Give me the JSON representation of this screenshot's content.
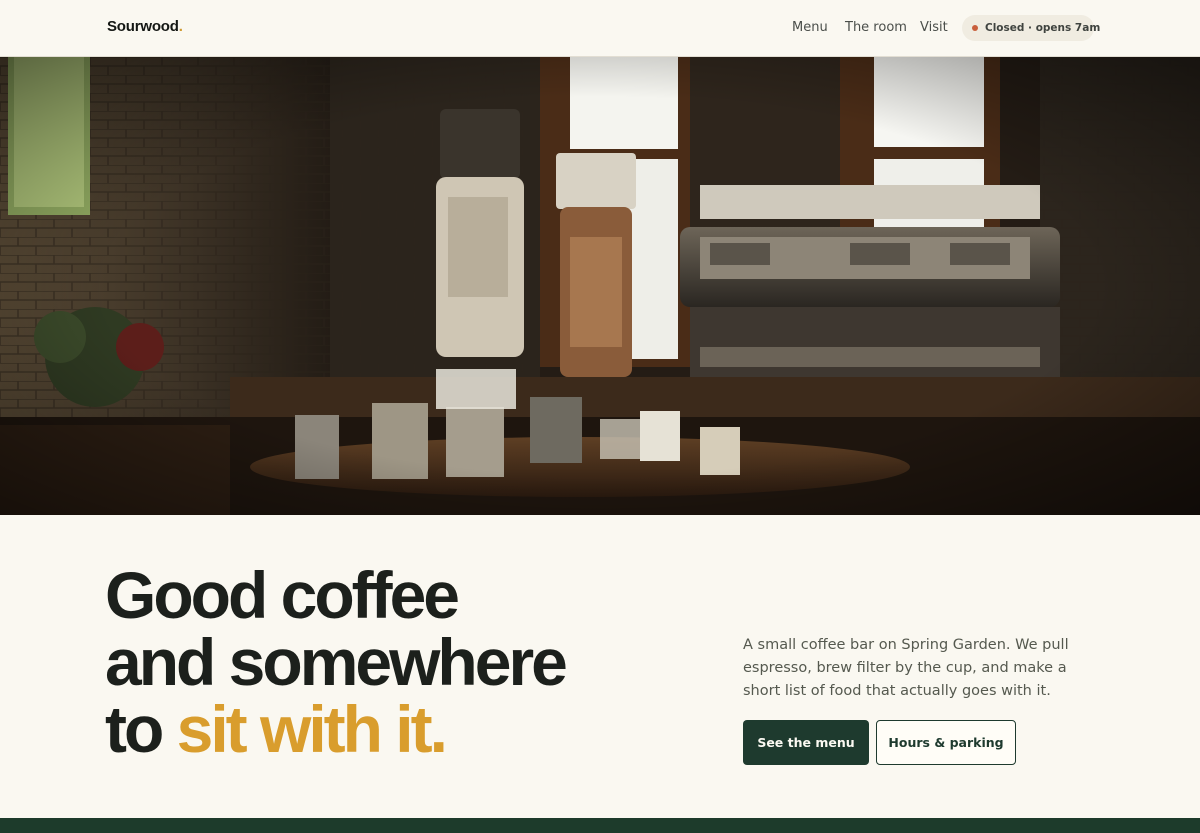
{
  "brand": {
    "name": "Sourwood",
    "dot": "."
  },
  "nav": {
    "items": [
      {
        "label": "Menu"
      },
      {
        "label": "The room"
      },
      {
        "label": "Visit"
      }
    ],
    "status": {
      "text": "Closed · opens 7am",
      "dot_color": "#c95f3c"
    }
  },
  "hero_image": {
    "subject": "espresso-bar-photo"
  },
  "headline": {
    "line1": "Good coffee",
    "line2": "and somewhere",
    "line3_lead": "to",
    "line3_accent": "sit with it."
  },
  "intro": {
    "text": "A small coffee bar on Spring Garden. We pull espresso, brew filter by the cup, and make a short list of food that actually goes with it."
  },
  "actions": {
    "primary": "See the menu",
    "secondary": "Hours & parking"
  },
  "colors": {
    "background": "#faf8f1",
    "accent": "#d99d2d",
    "brand_green": "#1e3a2e"
  }
}
